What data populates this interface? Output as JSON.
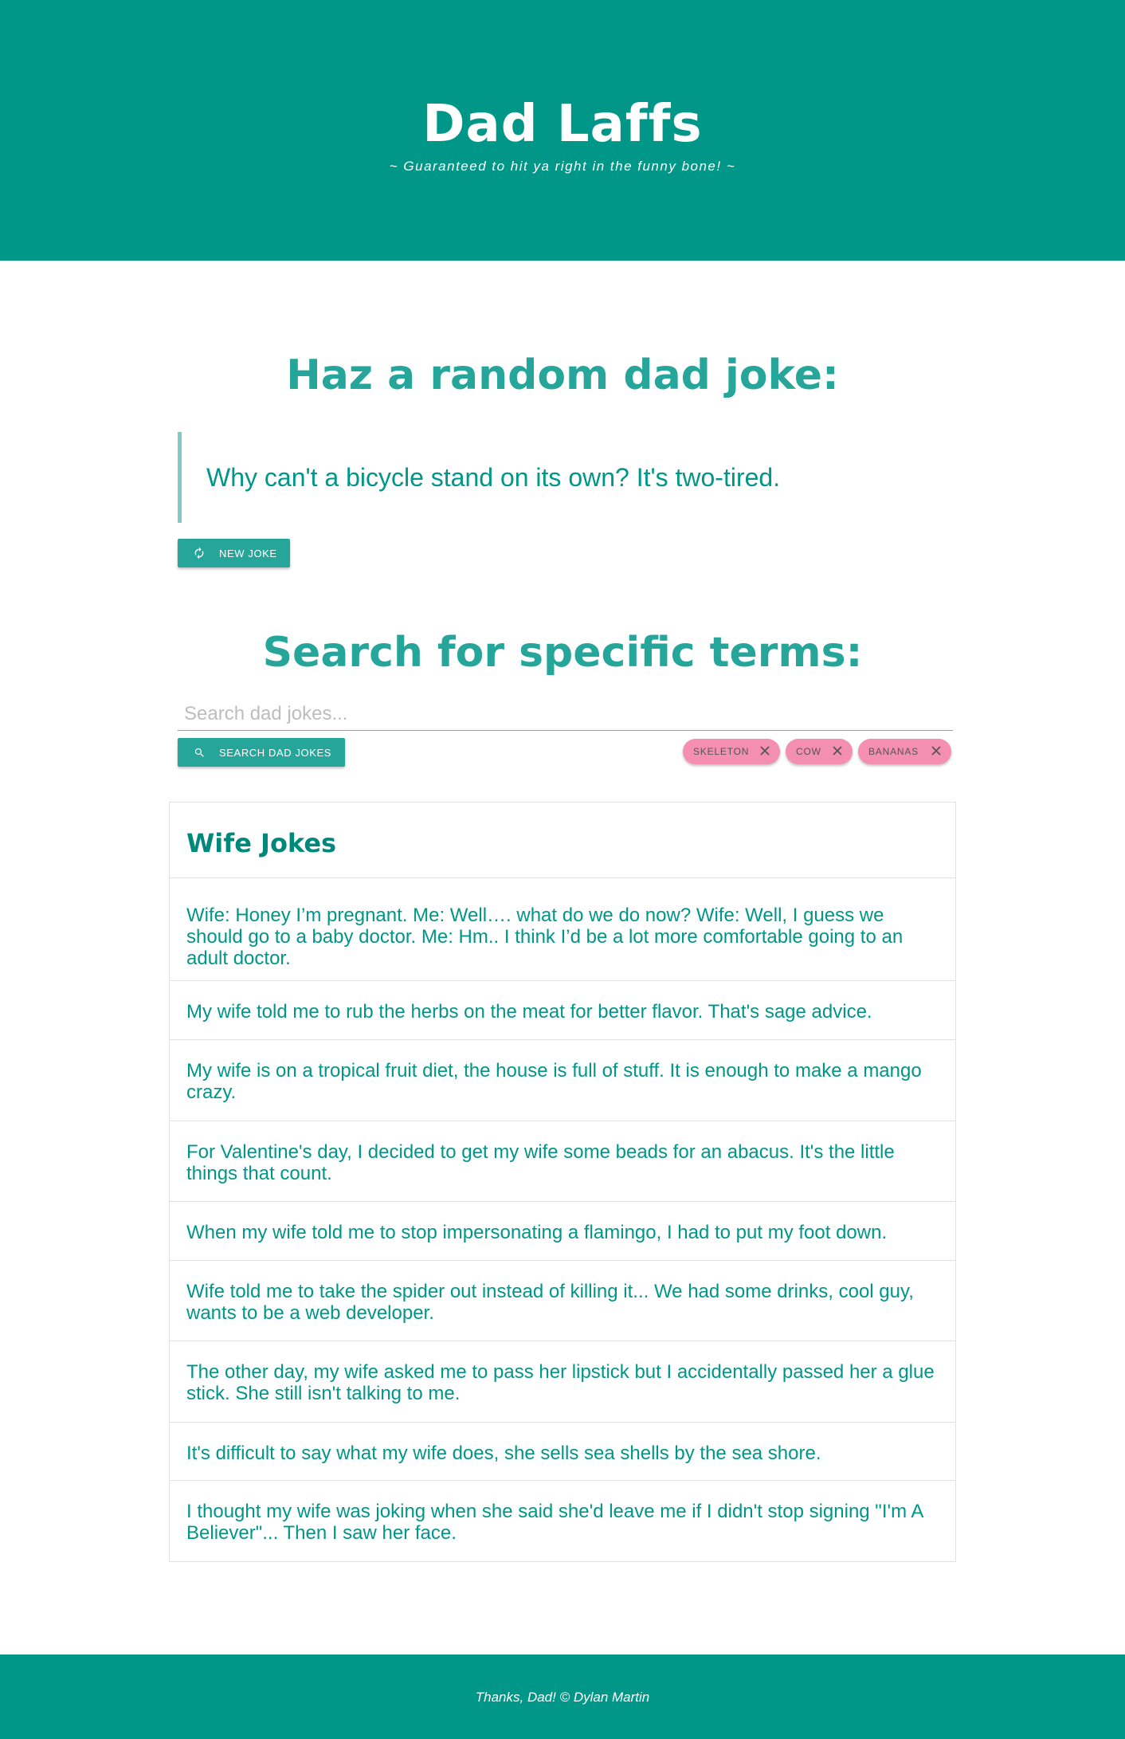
{
  "header": {
    "title": "Dad Laffs",
    "tagline": "~ Guaranteed to hit ya right in the funny bone! ~"
  },
  "random": {
    "heading": "Haz a random dad joke:",
    "joke": "Why can't a bicycle stand on its own? It's two-tired.",
    "button_label": "NEW JOKE",
    "button_icon": "refresh-icon"
  },
  "search": {
    "heading": "Search for specific terms:",
    "placeholder": "Search dad jokes...",
    "value": "",
    "button_label": "SEARCH DAD JOKES",
    "button_icon": "search-icon",
    "chips": [
      {
        "label": "SKELETON",
        "icon": "close-icon"
      },
      {
        "label": "COW",
        "icon": "close-icon"
      },
      {
        "label": "BANANAS",
        "icon": "close-icon"
      }
    ]
  },
  "results": {
    "title": "Wife Jokes",
    "items": [
      "Wife: Honey I’m pregnant. Me: Well…. what do we do now? Wife: Well, I guess we should go to a baby doctor. Me: Hm.. I think I’d be a lot more comfortable going to an adult doctor.",
      "My wife told me to rub the herbs on the meat for better flavor. That's sage advice.",
      "My wife is on a tropical fruit diet, the house is full of stuff. It is enough to make a mango crazy.",
      "For Valentine's day, I decided to get my wife some beads for an abacus. It's the little things that count.",
      "When my wife told me to stop impersonating a flamingo, I had to put my foot down.",
      "Wife told me to take the spider out instead of killing it... We had some drinks, cool guy, wants to be a web developer.",
      "The other day, my wife asked me to pass her lipstick but I accidentally passed her a glue stick. She still isn't talking to me.",
      "It's difficult to say what my wife does, she sells sea shells by the sea shore.",
      "I thought my wife was joking when she said she'd leave me if I didn't stop signing \"I'm A Believer\"... Then I saw her face."
    ]
  },
  "footer": {
    "text": "Thanks, Dad! © Dylan Martin"
  },
  "colors": {
    "primary": "#009688",
    "accent": "#26a69a",
    "quote_border": "#80cbc4",
    "chip": "#f48fb1"
  }
}
